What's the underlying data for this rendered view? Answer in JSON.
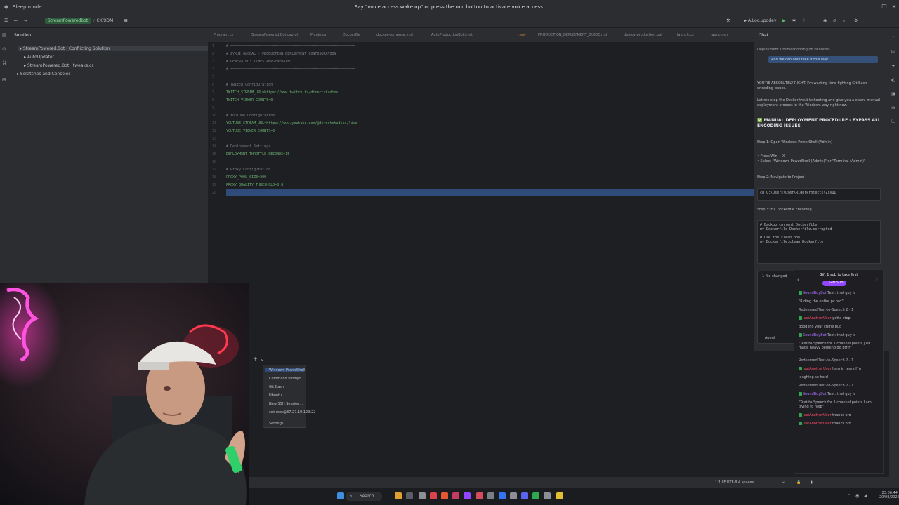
{
  "titlebar": {
    "app_title": "Sleep mode",
    "voice_prompt": "Say \"voice access wake up\" or press the mic button to activate voice access."
  },
  "toolbar": {
    "project": "StreamPoweredbot",
    "branch": "⑂ CK/XOM",
    "run_config": "▸ A.Loc.upddev"
  },
  "solution": {
    "header": "Solution",
    "rows": [
      "▾ StreamPowered.Bot · Conflicting Solution",
      "▸ AutoUpdater",
      "▸ StreamPowered.Bot · tweaks.cs",
      "▸ Scratches and Consoles"
    ]
  },
  "tabs": [
    "Program.cs",
    "StreamPowered.Bot.csproj",
    "Plugin.cs",
    "Dockerfile",
    "docker-compose.yml",
    "AutoProductionBot.Lvat",
    ".env",
    "PRODUCTION_DEPLOYMENT_GUIDE.md",
    "deploy-production.bat",
    "launch.cs",
    "launch.sh"
  ],
  "editor": {
    "lines": [
      {
        "n": "1",
        "text": "# ===========================================================",
        "kind": "sep"
      },
      {
        "n": "2",
        "text": "# ZYXUI GLOBAL - PRODUCTION DEPLOYMENT CONFIGURATION",
        "kind": "cm"
      },
      {
        "n": "3",
        "text": "# GENERATED: TIMESTAMPGENERATED",
        "kind": "cm"
      },
      {
        "n": "4",
        "text": "# ===========================================================",
        "kind": "sep"
      },
      {
        "n": "5",
        "text": "",
        "kind": "cm"
      },
      {
        "n": "6",
        "text": "# Twitch Configuration",
        "kind": "cm"
      },
      {
        "n": "7",
        "text": "TWITCH_STREAM_URL=https://www.twitch.tv/directstudios",
        "kind": "kv"
      },
      {
        "n": "8",
        "text": "TWITCH_VIEWER_COUNTS=0",
        "kind": "kv"
      },
      {
        "n": "9",
        "text": "",
        "kind": "cm"
      },
      {
        "n": "10",
        "text": "# YouTube Configuration",
        "kind": "cm"
      },
      {
        "n": "11",
        "text": "YOUTUBE_STREAM_URL=https://www.youtube.com/@directstudios/live",
        "kind": "kv"
      },
      {
        "n": "12",
        "text": "YOUTUBE_VIEWER_COUNTS=0",
        "kind": "kv"
      },
      {
        "n": "13",
        "text": "",
        "kind": "cm"
      },
      {
        "n": "14",
        "text": "# Deployment Settings",
        "kind": "cm"
      },
      {
        "n": "15",
        "text": "DEPLOYMENT_THROTTLE_SECONDS=15",
        "kind": "kv"
      },
      {
        "n": "16",
        "text": "",
        "kind": "cm"
      },
      {
        "n": "17",
        "text": "# Proxy Configuration",
        "kind": "cm"
      },
      {
        "n": "18",
        "text": "PROXY_POOL_SIZE=200",
        "kind": "kv"
      },
      {
        "n": "19",
        "text": "PROXY_QUALITY_THRESHOLD=0.8",
        "kind": "kv"
      },
      {
        "n": "20",
        "text": "",
        "kind": "cm"
      }
    ]
  },
  "chat": {
    "header": "Chat",
    "conversation": "Deployment Troubleshooting on Windows",
    "user_bubble": "And we can only take it this way.",
    "reply_intro": "YOU'RE ABSOLUTELY RIGHT. I'm wasting time fighting Git Bash encoding issues.",
    "reply_line2": "Let me stop the Docker troubleshooting and give you a clean, manual",
    "reply_line3": "deployment process in the Windows way right now.",
    "heading1": "✅ MANUAL DEPLOYMENT PROCEDURE - BYPASS ALL",
    "heading2": "ENCODING ISSUES",
    "step1": "Step 1: Open Windows PowerShell (Admin)",
    "step1_detail": "• Press Win + X\n• Select \"Windows PowerShell (Admin)\" or \"Terminal (Admin)\"",
    "step2": "Step 2: Navigate to Project",
    "step2_code": "cd C:\\Users\\User\\RiderProjects\\ZYXUI",
    "step3": "Step 3: Fix Dockerfile Encoding",
    "step3_code": "# Backup current Dockerfile\nmv Dockerfile Dockerfile.corrupted\n\n# Use the clean one\nmv Dockerfile.clean Dockerfile",
    "files_changed": "1 file changed",
    "agent_label": "Agent"
  },
  "terminal_menu": {
    "items": [
      "Windows PowerShell",
      "Command Prompt",
      "Git Bash",
      "Ubuntu",
      "New SSH Session…",
      "ssh root@37.27.19.129:22",
      "Settings"
    ]
  },
  "status": {
    "right_text": "1:1  LF  UTF-8  4 spaces"
  },
  "taskbar": {
    "search": "Search",
    "time": "23:06:44",
    "date": "20/08/2025"
  },
  "twitch": {
    "title": "Gift 1 sub to take first",
    "badge": "1 Gift Sub",
    "messages": [
      {
        "user": "SoundBoyBot",
        "text": "Text: that guy is",
        "kind": "msg"
      },
      {
        "user": "",
        "text": "\"Riding the entire pc red\"",
        "kind": "msg"
      },
      {
        "user": "",
        "text": "Redeemed Text-to-Speech 2 · 1",
        "kind": "redeem"
      },
      {
        "user": "JustAnotherUser",
        "text": "gotta stop",
        "kind": "msg2"
      },
      {
        "user": "",
        "text": "googling your crime bud",
        "kind": "msg"
      },
      {
        "user": "SoundBoyBot",
        "text": "Text: that guy is",
        "kind": "msg"
      },
      {
        "user": "",
        "text": "\"Text-to-Speech for 1 channel points just made heavy begging go brrrr\"",
        "kind": "msg"
      },
      {
        "user": "",
        "text": "Redeemed Text-to-Speech 2 · 1",
        "kind": "redeem"
      },
      {
        "user": "JustAnotherUser",
        "text": "I am in tears I'm",
        "kind": "msg2"
      },
      {
        "user": "",
        "text": "laughing so hard",
        "kind": "msg"
      },
      {
        "user": "",
        "text": "Redeemed Text-to-Speech 2 · 1",
        "kind": "redeem"
      },
      {
        "user": "SoundBoyBot",
        "text": "Text: that guy is",
        "kind": "msg"
      },
      {
        "user": "",
        "text": "\"Text-to-Speech for 1 channel points I am trying to help\"",
        "kind": "msg"
      },
      {
        "user": "JustAnotherUser",
        "text": "thanks bro",
        "kind": "msg2"
      },
      {
        "user": "JustAnotherUser",
        "text": "thanks bro",
        "kind": "msg2"
      }
    ]
  },
  "colors": {
    "accent": "#2e4b7a",
    "twitch_purple": "#9147ff",
    "neon_pink": "#ff2fd4"
  }
}
